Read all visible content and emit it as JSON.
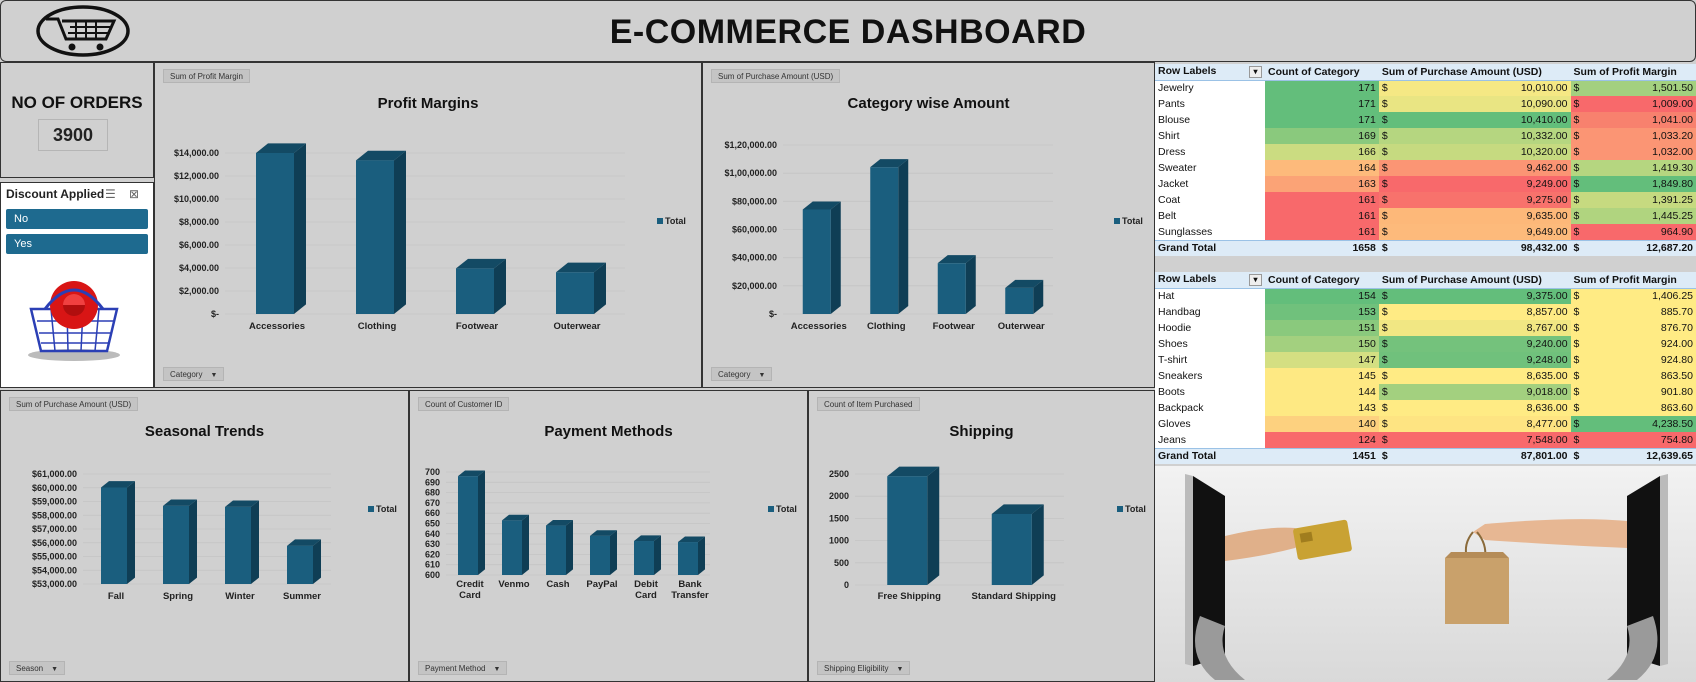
{
  "header": {
    "title": "E-COMMERCE DASHBOARD",
    "logo": "shopping-cart-icon"
  },
  "orders": {
    "label": "NO OF ORDERS",
    "value": "3900"
  },
  "slicer": {
    "title": "Discount Applied",
    "items": [
      "No",
      "Yes"
    ],
    "image": "shopping-basket-icon"
  },
  "legend_label": "Total",
  "charts": [
    {
      "id": "profit",
      "title": "Profit Margins",
      "field": "Sum of Profit Margin",
      "axis_field": "Category",
      "chart_data": {
        "type": "bar",
        "title": "Profit Margins",
        "categories": [
          "Accessories",
          "Clothing",
          "Footwear",
          "Outerwear"
        ],
        "values": [
          14365.52,
          13363.28,
          3962.49,
          3632.36
        ],
        "ylim": [
          0,
          14000
        ],
        "yticks": [
          "$-",
          "$2,000.00",
          "$4,000.00",
          "$6,000.00",
          "$8,000.00",
          "$10,000.00",
          "$12,000.00",
          "$14,000.00"
        ],
        "series": [
          {
            "name": "Total"
          }
        ],
        "legend": "right"
      }
    },
    {
      "id": "category",
      "title": "Category wise Amount",
      "field": "Sum of Purchase Amount (USD)",
      "axis_field": "Category",
      "chart_data": {
        "type": "bar",
        "title": "Category wise Amount",
        "categories": [
          "Accessories",
          "Clothing",
          "Footwear",
          "Outerwear"
        ],
        "values": [
          74200,
          104264,
          36093,
          18524
        ],
        "ylim": [
          0,
          120000
        ],
        "yticks": [
          "$-",
          "$20,000.00",
          "$40,000.00",
          "$60,000.00",
          "$80,000.00",
          "$1,00,000.00",
          "$1,20,000.00"
        ],
        "series": [
          {
            "name": "Total"
          }
        ],
        "legend": "right"
      }
    },
    {
      "id": "season",
      "title": "Seasonal Trends",
      "field": "Sum of Purchase Amount (USD)",
      "axis_field": "Season",
      "chart_data": {
        "type": "bar",
        "title": "Seasonal Trends",
        "categories": [
          "Fall",
          "Spring",
          "Winter",
          "Summer"
        ],
        "values": [
          60018,
          58679,
          58607,
          55777
        ],
        "ylim": [
          53000,
          61000
        ],
        "yticks": [
          "$53,000.00",
          "$54,000.00",
          "$55,000.00",
          "$56,000.00",
          "$57,000.00",
          "$58,000.00",
          "$59,000.00",
          "$60,000.00",
          "$61,000.00"
        ],
        "series": [
          {
            "name": "Total"
          }
        ],
        "legend": "right"
      }
    },
    {
      "id": "payment",
      "title": "Payment Methods",
      "field": "Count of Customer ID",
      "axis_field": "Payment Method",
      "chart_data": {
        "type": "bar",
        "title": "Payment Methods",
        "categories": [
          "Credit Card",
          "Venmo",
          "Cash",
          "PayPal",
          "Debit Card",
          "Bank Transfer"
        ],
        "values": [
          696,
          653,
          648,
          638,
          633,
          632
        ],
        "ylim": [
          600,
          700
        ],
        "yticks": [
          "600",
          "610",
          "620",
          "630",
          "640",
          "650",
          "660",
          "670",
          "680",
          "690",
          "700"
        ],
        "series": [
          {
            "name": "Total"
          }
        ],
        "legend": "right"
      }
    },
    {
      "id": "shipping",
      "title": "Shipping",
      "field": "Count of Item Purchased",
      "axis_field": "Shipping Eligibility",
      "chart_data": {
        "type": "bar",
        "title": "Shipping",
        "categories": [
          "Free Shipping",
          "Standard Shipping"
        ],
        "values": [
          2450,
          1600
        ],
        "ylim": [
          0,
          2500
        ],
        "yticks": [
          "0",
          "500",
          "1000",
          "1500",
          "2000",
          "2500"
        ],
        "series": [
          {
            "name": "Total"
          }
        ],
        "legend": "right"
      }
    }
  ],
  "table1": {
    "headers": [
      "Row Labels",
      "Count of Category",
      "Sum of Purchase Amount (USD)",
      "Sum of Profit Margin"
    ],
    "rows": [
      [
        "Jewelry",
        "171",
        "10,010.00",
        "1,501.50"
      ],
      [
        "Pants",
        "171",
        "10,090.00",
        "1,009.00"
      ],
      [
        "Blouse",
        "171",
        "10,410.00",
        "1,041.00"
      ],
      [
        "Shirt",
        "169",
        "10,332.00",
        "1,033.20"
      ],
      [
        "Dress",
        "166",
        "10,320.00",
        "1,032.00"
      ],
      [
        "Sweater",
        "164",
        "9,462.00",
        "1,419.30"
      ],
      [
        "Jacket",
        "163",
        "9,249.00",
        "1,849.80"
      ],
      [
        "Coat",
        "161",
        "9,275.00",
        "1,391.25"
      ],
      [
        "Belt",
        "161",
        "9,635.00",
        "1,445.25"
      ],
      [
        "Sunglasses",
        "161",
        "9,649.00",
        "964.90"
      ]
    ],
    "colors": [
      [
        "#63be7b",
        "#f5e884",
        "#a3d07f"
      ],
      [
        "#63be7b",
        "#e9e583",
        "#f8696b"
      ],
      [
        "#63be7b",
        "#63be7b",
        "#f8816e"
      ],
      [
        "#8ac97d",
        "#b5d680",
        "#fb9574"
      ],
      [
        "#cbdc81",
        "#c6da80",
        "#fb9574"
      ],
      [
        "#fdba7b",
        "#fb9574",
        "#b5d680"
      ],
      [
        "#fba376",
        "#f8696b",
        "#63be7b"
      ],
      [
        "#f8696b",
        "#f8726c",
        "#c6da80"
      ],
      [
        "#f8696b",
        "#fdb879",
        "#b0d47f"
      ],
      [
        "#f8696b",
        "#fdba7b",
        "#f8696b"
      ]
    ],
    "grand_total": [
      "Grand Total",
      "1658",
      "98,432.00",
      "12,687.20"
    ]
  },
  "table2": {
    "headers": [
      "Row Labels",
      "Count of Category",
      "Sum of Purchase Amount (USD)",
      "Sum of Profit Margin"
    ],
    "rows": [
      [
        "Hat",
        "154",
        "9,375.00",
        "1,406.25"
      ],
      [
        "Handbag",
        "153",
        "8,857.00",
        "885.70"
      ],
      [
        "Hoodie",
        "151",
        "8,767.00",
        "876.70"
      ],
      [
        "Shoes",
        "150",
        "9,240.00",
        "924.00"
      ],
      [
        "T-shirt",
        "147",
        "9,248.00",
        "924.80"
      ],
      [
        "Sneakers",
        "145",
        "8,635.00",
        "863.50"
      ],
      [
        "Boots",
        "144",
        "9,018.00",
        "901.80"
      ],
      [
        "Backpack",
        "143",
        "8,636.00",
        "863.60"
      ],
      [
        "Gloves",
        "140",
        "8,477.00",
        "4,238.50"
      ],
      [
        "Jeans",
        "124",
        "7,548.00",
        "754.80"
      ]
    ],
    "colors": [
      [
        "#63be7b",
        "#63be7b",
        "#ffeb84"
      ],
      [
        "#70c17c",
        "#ffeb84",
        "#ffeb84"
      ],
      [
        "#8ac97d",
        "#f1e783",
        "#ffeb84"
      ],
      [
        "#a3d07f",
        "#74c27c",
        "#ffeb84"
      ],
      [
        "#d4df82",
        "#70c17c",
        "#ffeb84"
      ],
      [
        "#fee983",
        "#ffeb84",
        "#ffeb84"
      ],
      [
        "#fee983",
        "#a3d07f",
        "#ffeb84"
      ],
      [
        "#fee983",
        "#ffeb84",
        "#ffeb84"
      ],
      [
        "#fdd17f",
        "#fee482",
        "#63be7b"
      ],
      [
        "#f8696b",
        "#f8696b",
        "#f8696b"
      ]
    ],
    "grand_total": [
      "Grand Total",
      "1451",
      "87,801.00",
      "12,639.65"
    ]
  },
  "currency_symbol": "$",
  "bottom_image": "online-shopping-illustration",
  "colors": {
    "bar": "#1a5e7e",
    "bar_top": "#134a64",
    "bar_side": "#0f3e55",
    "slicer_item": "#1e6a8f",
    "header_row": "#ddebf7"
  }
}
